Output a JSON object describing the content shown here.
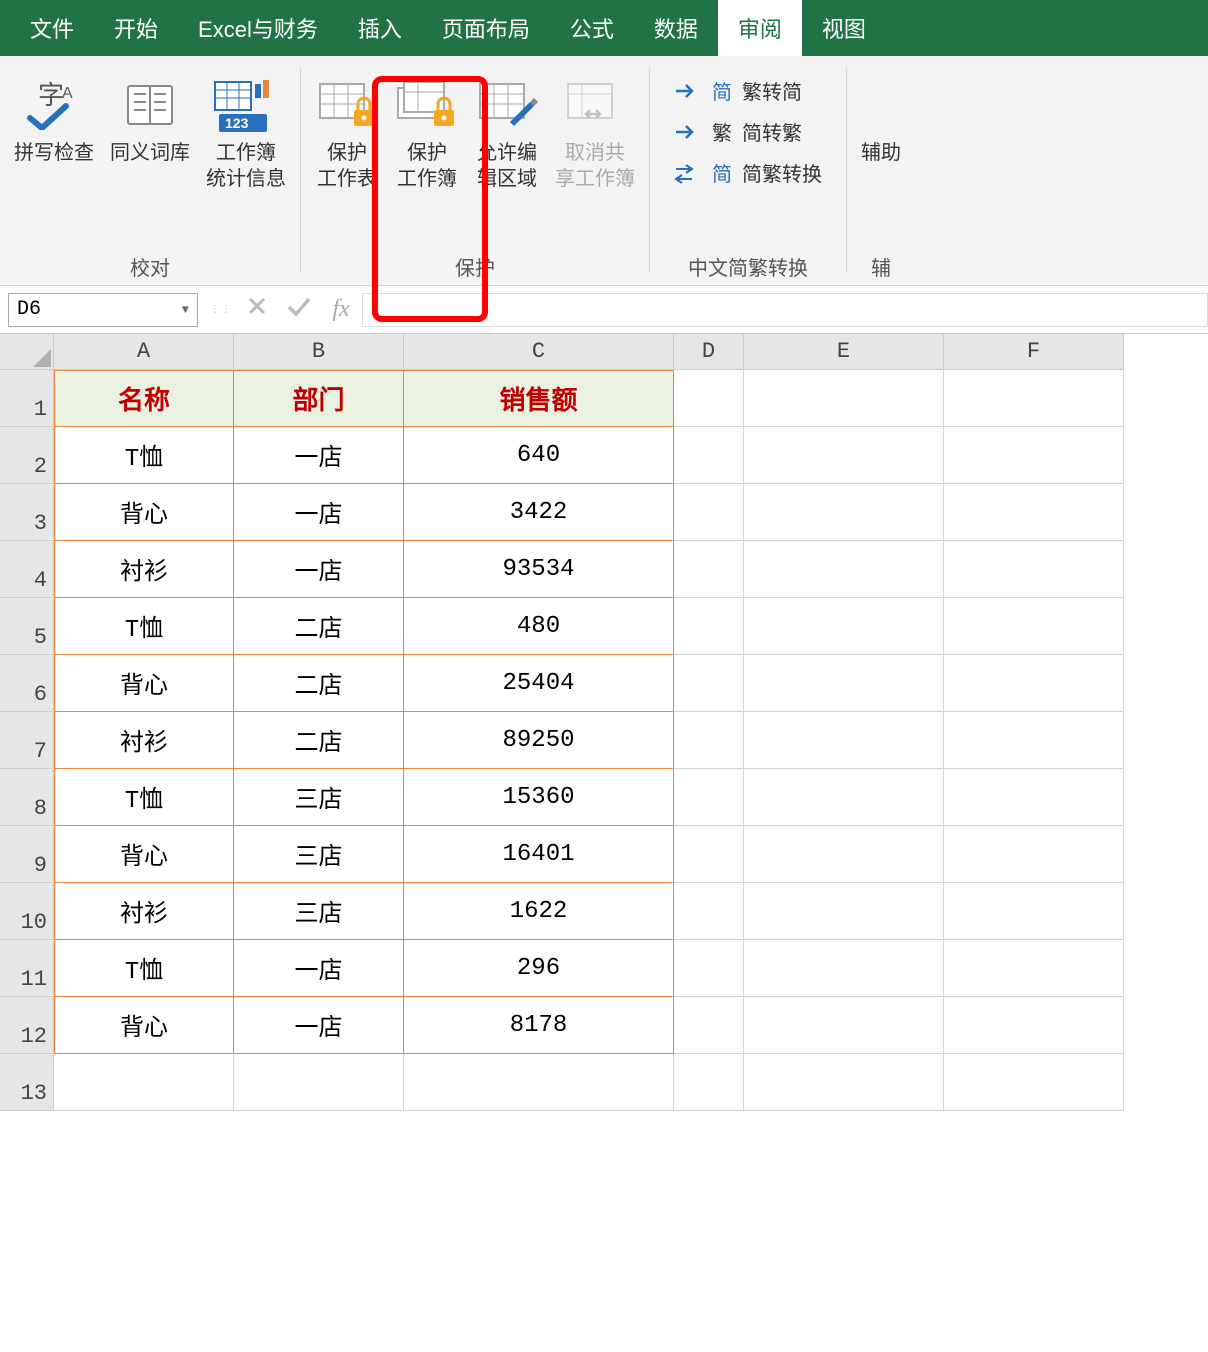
{
  "menu": {
    "items": [
      "文件",
      "开始",
      "Excel与财务",
      "插入",
      "页面布局",
      "公式",
      "数据",
      "审阅",
      "视图"
    ],
    "active_index": 7
  },
  "ribbon": {
    "groups": [
      {
        "label": "校对",
        "buttons": [
          {
            "label": "拼写检查",
            "icon": "spellcheck"
          },
          {
            "label": "同义词库",
            "icon": "thesaurus"
          },
          {
            "label": "工作簿\n统计信息",
            "icon": "stats"
          }
        ]
      },
      {
        "label": "保护",
        "buttons": [
          {
            "label": "保护\n工作表",
            "icon": "protect-sheet",
            "highlighted": true
          },
          {
            "label": "保护\n工作簿",
            "icon": "protect-book"
          },
          {
            "label": "允许编\n辑区域",
            "icon": "edit-range"
          },
          {
            "label": "取消共\n享工作簿",
            "icon": "unshare",
            "disabled": true
          }
        ]
      },
      {
        "label": "中文简繁转换",
        "cn_rows": [
          {
            "badge": "简",
            "label": "繁转简"
          },
          {
            "badge": "繁",
            "label": "简转繁"
          },
          {
            "badge": "简",
            "label": "简繁转换",
            "arrows": true
          }
        ]
      },
      {
        "label": "辅",
        "buttons": [
          {
            "label": "辅助",
            "icon": "generic"
          }
        ]
      }
    ]
  },
  "formula_bar": {
    "name_box": "D6",
    "fx_label": "fx"
  },
  "grid": {
    "columns": [
      "A",
      "B",
      "C",
      "D",
      "E",
      "F"
    ],
    "headers": [
      "名称",
      "部门",
      "销售额"
    ],
    "rows": [
      [
        "T恤",
        "一店",
        "640"
      ],
      [
        "背心",
        "一店",
        "3422"
      ],
      [
        "衬衫",
        "一店",
        "93534"
      ],
      [
        "T恤",
        "二店",
        "480"
      ],
      [
        "背心",
        "二店",
        "25404"
      ],
      [
        "衬衫",
        "二店",
        "89250"
      ],
      [
        "T恤",
        "三店",
        "15360"
      ],
      [
        "背心",
        "三店",
        "16401"
      ],
      [
        "衬衫",
        "三店",
        "1622"
      ],
      [
        "T恤",
        "一店",
        "296"
      ],
      [
        "背心",
        "一店",
        "8178"
      ]
    ],
    "total_rows": 13
  }
}
